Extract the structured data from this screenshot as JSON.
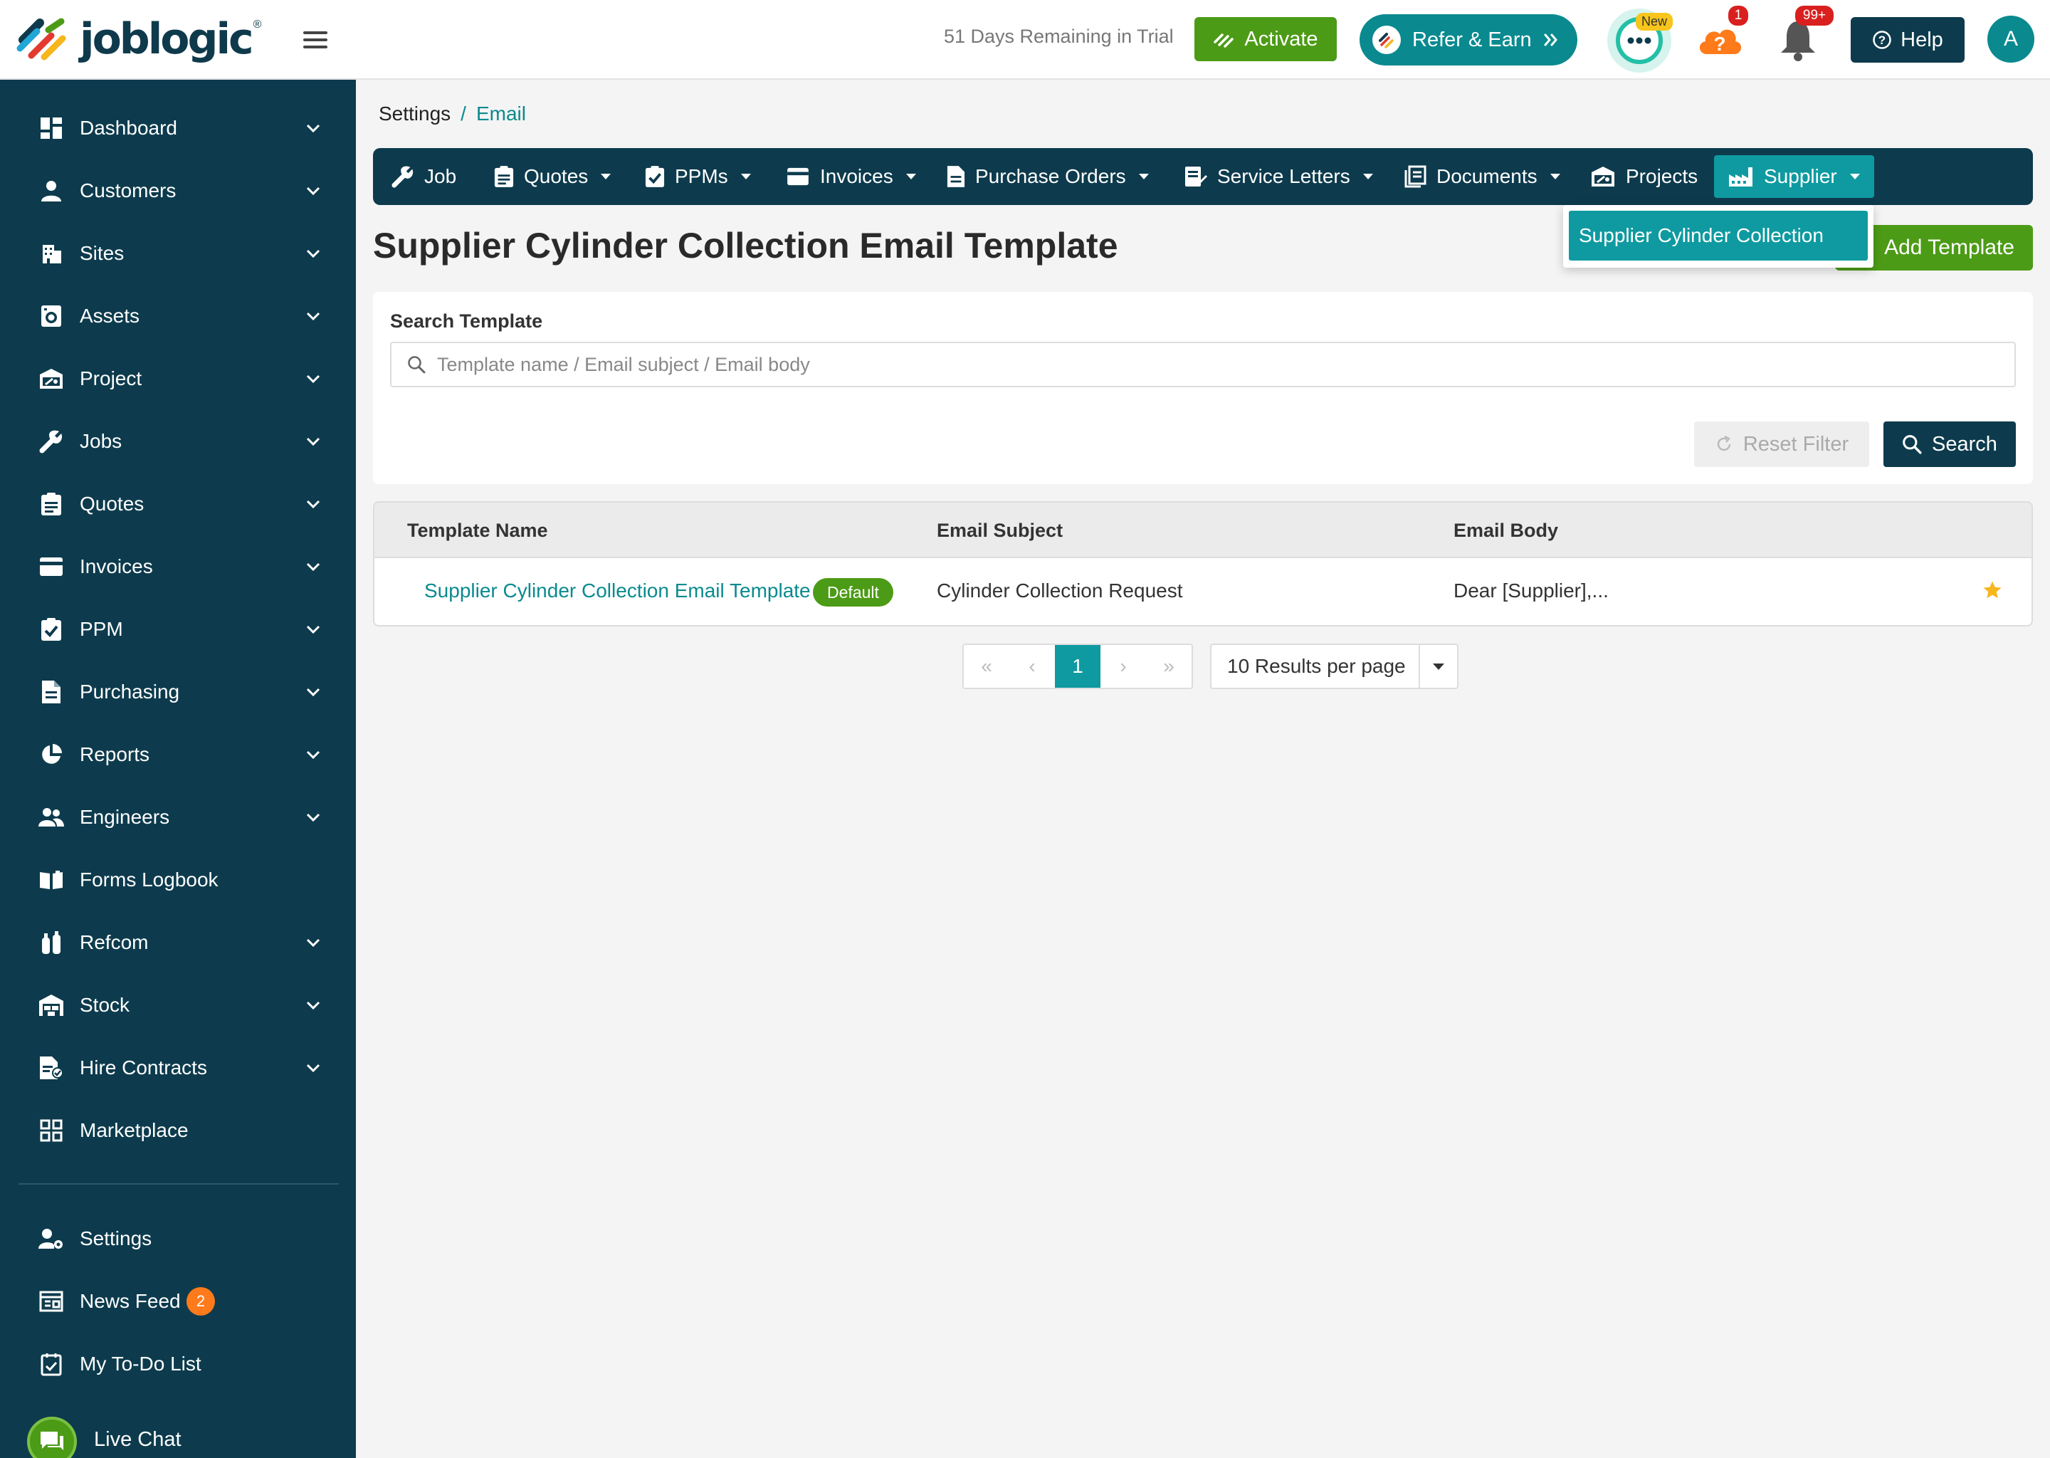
{
  "header": {
    "logo_text": "joblogic",
    "logo_reg": "®",
    "trial_text": "51 Days Remaining in Trial",
    "activate_label": "Activate",
    "refer_label": "Refer & Earn",
    "new_badge": "New",
    "help_notifications": "1",
    "bell_notifications": "99+",
    "help_label": "Help",
    "avatar_initial": "A"
  },
  "sidebar": {
    "items": [
      {
        "label": "Dashboard",
        "icon": "dashboard-icon"
      },
      {
        "label": "Customers",
        "icon": "person-icon"
      },
      {
        "label": "Sites",
        "icon": "building-icon"
      },
      {
        "label": "Assets",
        "icon": "washing-machine-icon"
      },
      {
        "label": "Project",
        "icon": "project-icon"
      },
      {
        "label": "Jobs",
        "icon": "wrench-icon"
      },
      {
        "label": "Quotes",
        "icon": "clipboard-icon"
      },
      {
        "label": "Invoices",
        "icon": "card-icon"
      },
      {
        "label": "PPM",
        "icon": "clipboard-check-icon"
      },
      {
        "label": "Purchasing",
        "icon": "document-icon"
      },
      {
        "label": "Reports",
        "icon": "pie-chart-icon"
      },
      {
        "label": "Engineers",
        "icon": "people-icon"
      },
      {
        "label": "Forms Logbook",
        "icon": "book-icon"
      },
      {
        "label": "Refcom",
        "icon": "cylinder-icon"
      },
      {
        "label": "Stock",
        "icon": "warehouse-icon"
      },
      {
        "label": "Hire Contracts",
        "icon": "contract-icon"
      },
      {
        "label": "Marketplace",
        "icon": "grid-icon"
      }
    ],
    "bottom": [
      {
        "label": "Settings",
        "icon": "user-gear-icon"
      },
      {
        "label": "News Feed",
        "icon": "newspaper-icon",
        "badge": "2"
      },
      {
        "label": "My To-Do List",
        "icon": "todo-icon"
      }
    ],
    "live_chat_label": "Live Chat"
  },
  "breadcrumb": {
    "root": "Settings",
    "separator": "/",
    "current": "Email"
  },
  "tabs": [
    {
      "label": "Job"
    },
    {
      "label": "Quotes"
    },
    {
      "label": "PPMs"
    },
    {
      "label": "Invoices"
    },
    {
      "label": "Purchase Orders"
    },
    {
      "label": "Service Letters"
    },
    {
      "label": "Documents"
    },
    {
      "label": "Projects"
    },
    {
      "label": "Supplier"
    }
  ],
  "dropdown": {
    "item": "Supplier Cylinder Collection"
  },
  "page": {
    "title": "Supplier Cylinder Collection Email Template",
    "add_label": "Add Template"
  },
  "filter": {
    "label": "Search Template",
    "placeholder": "Template name / Email subject / Email body",
    "reset_label": "Reset Filter",
    "search_label": "Search"
  },
  "table": {
    "headers": [
      "Template Name",
      "Email Subject",
      "Email Body"
    ],
    "rows": [
      {
        "name": "Supplier Cylinder Collection Email Template",
        "badge": "Default",
        "subject": "Cylinder Collection Request",
        "body": "Dear [Supplier],..."
      }
    ]
  },
  "pagination": {
    "first": "«",
    "prev": "‹",
    "current": "1",
    "next": "›",
    "last": "»",
    "per_page": "10 Results per page"
  },
  "colors": {
    "navy": "#0d3b4d",
    "teal": "#0e9aa0",
    "green": "#4c9b16",
    "orange": "#ff7a1a",
    "red": "#d9201f"
  }
}
